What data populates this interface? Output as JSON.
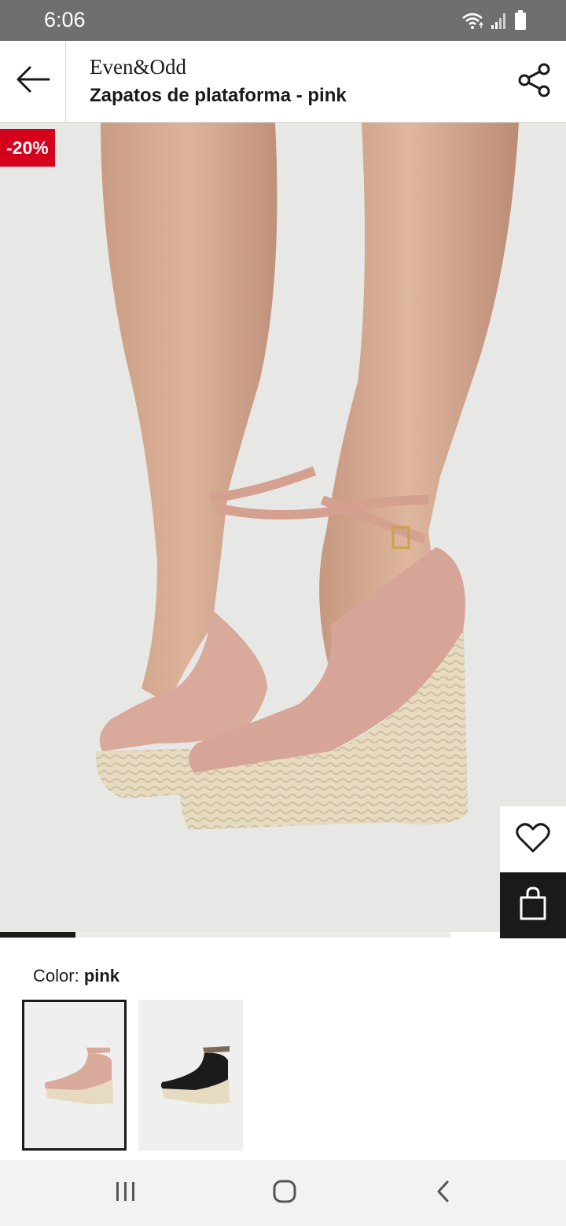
{
  "status_bar": {
    "time": "6:06",
    "icons": [
      "wifi-icon",
      "signal-icon",
      "battery-icon"
    ]
  },
  "header": {
    "brand": "Even&Odd",
    "title": "Zapatos de plataforma - pink",
    "back_icon": "arrow-left-icon",
    "share_icon": "share-icon"
  },
  "product_image": {
    "discount_badge": "-20%",
    "wishlist_icon": "heart-icon",
    "bag_icon": "shopping-bag-icon"
  },
  "carousel": {
    "current_index": 1,
    "total": 6
  },
  "color": {
    "label": "Color:",
    "selected": "pink",
    "swatches": [
      {
        "name": "pink",
        "selected": true
      },
      {
        "name": "black",
        "selected": false
      }
    ]
  },
  "nav_bar": {
    "icons": [
      "recent-apps-icon",
      "home-icon",
      "back-icon"
    ]
  },
  "colors": {
    "status_bar": "#6f6f6f",
    "discount_badge": "#d5001c",
    "primary": "#1a1a1a",
    "shoe_pink": "#d9aa9c",
    "espadrille": "#e8dcc0"
  }
}
